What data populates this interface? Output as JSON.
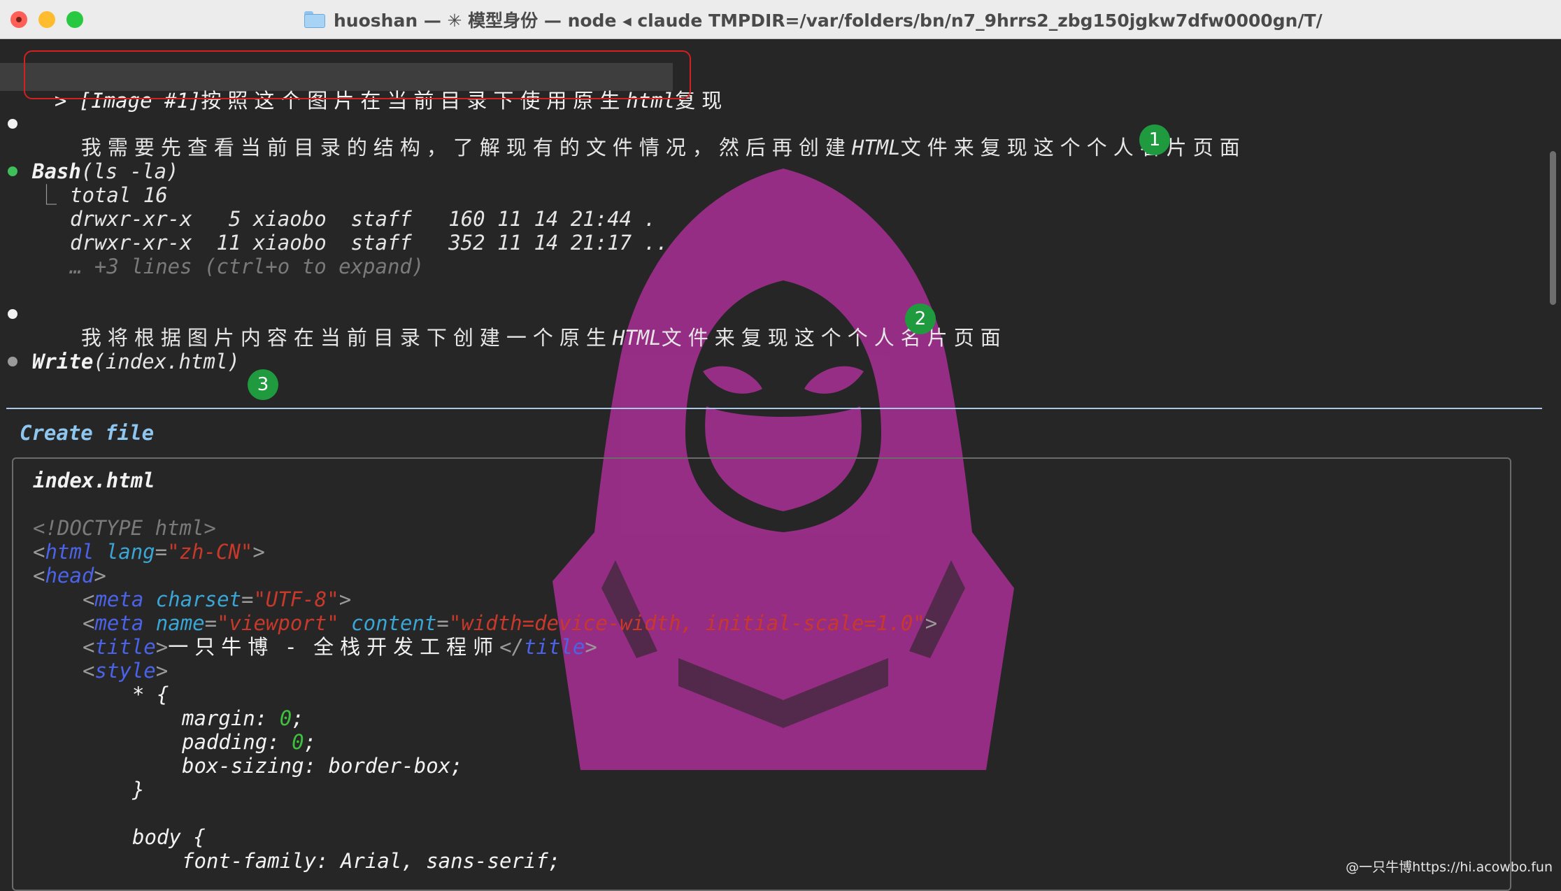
{
  "window": {
    "title": "huoshan — ✳ 模型身份 — node ◂ claude TMPDIR=/var/folders/bn/n7_9hrrs2_zbg150jgkw7dfw0000gn/T/"
  },
  "prompt": {
    "symbol": ">",
    "image_tag": "[Image #1]",
    "text_a": "按照这个图片在当前目录下使用原生",
    "text_html": "html",
    "text_b": "复现"
  },
  "messages": [
    {
      "part_a": "我需要先查看当前目录的结构，了解现有的文件情况，然后再创建",
      "part_em": "HTML",
      "part_b": "文件来复现这个个人名片页面"
    },
    {
      "part_a": "我将根据图片内容在当前目录下创建一个原生",
      "part_em": "HTML",
      "part_b": "文件来复现这个个人名片页面"
    }
  ],
  "bash": {
    "tool": "Bash",
    "args": "(ls -la)",
    "branch": "⎿",
    "output": [
      "total 16",
      "drwxr-xr-x   5 xiaobo  staff   160 11 14 21:44 .",
      "drwxr-xr-x  11 xiaobo  staff   352 11 14 21:17 .."
    ],
    "more": "… +3 lines (ctrl+o to expand)"
  },
  "write": {
    "tool": "Write",
    "args": "(index.html)"
  },
  "create_file": {
    "label": "Create file",
    "filename": "index.html"
  },
  "code": {
    "doctype": "<!DOCTYPE html>",
    "html_tag": "html",
    "lang_attr": "lang",
    "lang_val": "\"zh-CN\"",
    "head_tag": "head",
    "meta_tag": "meta",
    "charset_attr": "charset",
    "charset_val": "\"UTF-8\"",
    "name_attr": "name",
    "name_val": "\"viewport\"",
    "content_attr": "content",
    "content_val": "\"width=device-width, initial-scale=1.0\"",
    "title_tag": "title",
    "title_text": "一只牛博 - 全栈开发工程师",
    "style_tag": "style",
    "star_rule": "* {",
    "margin_prop": "margin: ",
    "margin_val": "0",
    "padding_prop": "padding: ",
    "padding_val": "0",
    "boxsizing": "box-sizing: border-box;",
    "close_brace": "}",
    "body_rule": "body {",
    "font_family": "font-family: Arial, sans-serif;"
  },
  "badges": [
    "1",
    "2",
    "3"
  ],
  "footer": "@一只牛博https://hi.acowbo.fun",
  "colors": {
    "background": "#262626",
    "prompt_border": "#d32020",
    "badge": "#1f9a3f",
    "watermark": "#b0309a",
    "divider": "#a9c7e6"
  }
}
